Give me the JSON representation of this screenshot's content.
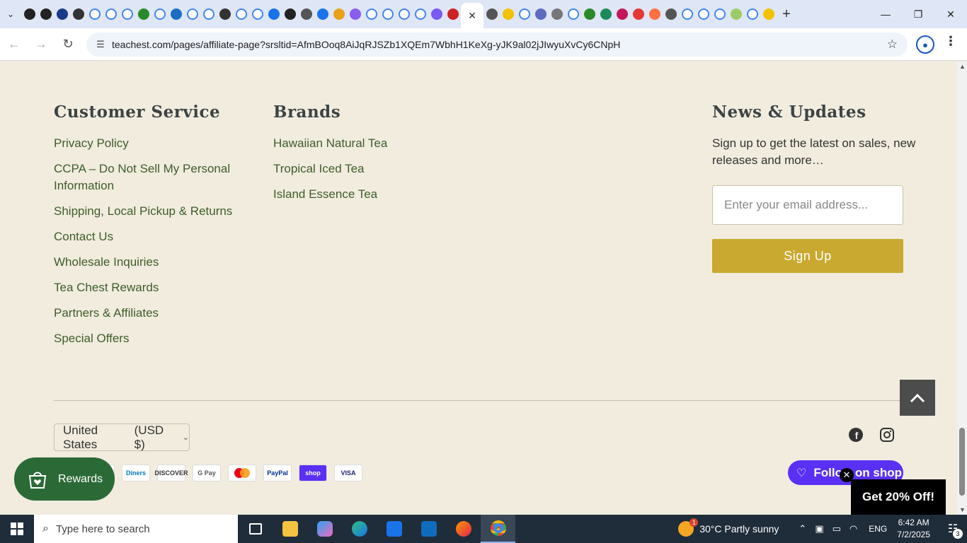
{
  "browser": {
    "url": "teachest.com/pages/affiliate-page?srsltid=AfmBOoq8AiJqRJSZb1XQEm7WbhH1KeXg-yJK9al02jJIwyuXvCy6CNpH",
    "tab_favicons": [
      "#222",
      "#222",
      "#1b3a8a",
      "#333",
      "#e8e8e8",
      "#e8e8e8",
      "#e8e8e8",
      "#2a8a2a",
      "#e8e8e8",
      "#1b6ec2",
      "#e8e8e8",
      "#e8e8e8",
      "#333",
      "#e8e8e8",
      "#e8e8e8",
      "#1a73e8",
      "#222",
      "#555",
      "#1a73e8",
      "#e8a21a",
      "#8a5cf0",
      "#e8e8e8",
      "#e8e8e8",
      "#e8e8e8",
      "#e8e8e8",
      "#7a5af0",
      "#cc2222"
    ],
    "tab_favicons_after": [
      "#555",
      "#f2c200",
      "#e8e8e8",
      "#5c6bc0",
      "#777",
      "#e8e8e8",
      "#2a8a2a",
      "#1b8a5a",
      "#c2185b",
      "#e53935",
      "#ff7043",
      "#555",
      "#e8e8e8",
      "#e8e8e8",
      "#e8e8e8",
      "#9ccc65",
      "#e8e8e8",
      "#f2c200"
    ]
  },
  "footer": {
    "customer_service": {
      "title": "Customer Service",
      "links": [
        "Privacy Policy",
        "CCPA – Do Not Sell My Personal Information",
        "Shipping, Local Pickup & Returns",
        "Contact Us",
        "Wholesale Inquiries",
        "Tea Chest Rewards",
        "Partners & Affiliates",
        "Special Offers"
      ]
    },
    "brands": {
      "title": "Brands",
      "links": [
        "Hawaiian Natural Tea",
        "Tropical Iced Tea",
        "Island Essence Tea"
      ]
    },
    "news": {
      "title": "News & Updates",
      "text": "Sign up to get the latest on sales, new releases and more…",
      "email_placeholder": "Enter your email address...",
      "button": "Sign Up"
    },
    "country": {
      "label": "United States",
      "currency": "(USD $)"
    },
    "payments": [
      "Diners",
      "DISCOVER",
      "G Pay",
      "Mastercard",
      "PayPal",
      "shop",
      "VISA"
    ],
    "rewards_label": "Rewards",
    "follow_shop": "Follow on shop",
    "promo": "Get 20% Off!",
    "accent": "#c9a92f",
    "link_color": "#3f5d2a"
  },
  "taskbar": {
    "search_placeholder": "Type here to search",
    "weather": "30°C  Partly sunny",
    "language": "ENG",
    "time": "6:42 AM",
    "date": "7/2/2025",
    "notifications": "3"
  }
}
